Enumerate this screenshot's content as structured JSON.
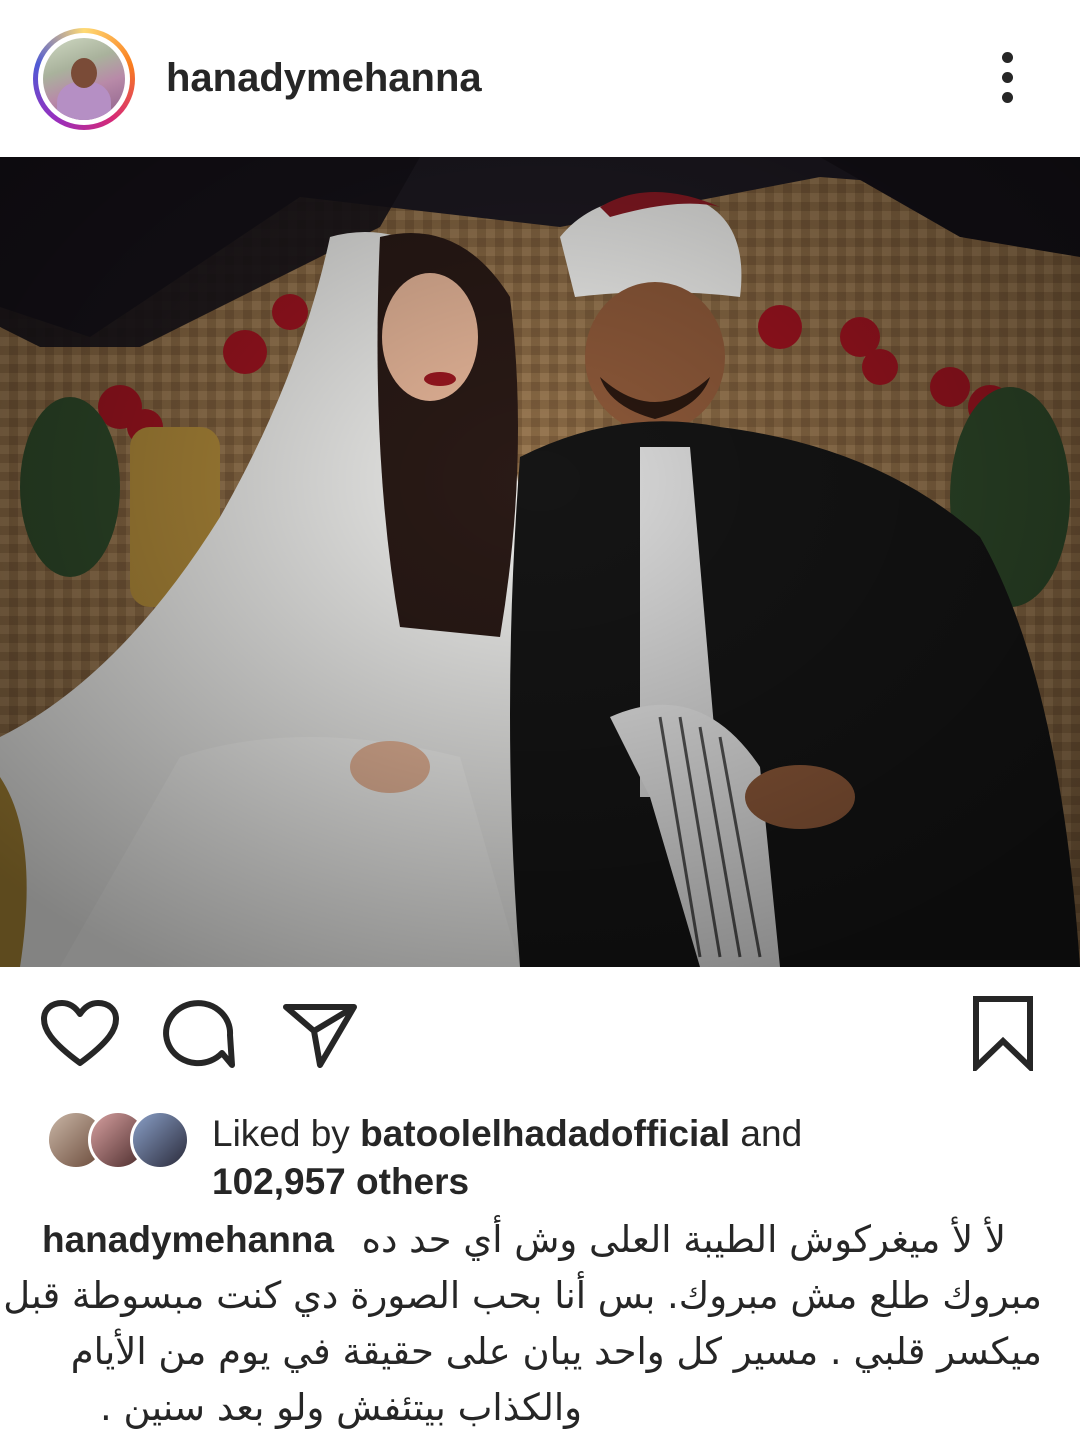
{
  "post": {
    "username": "hanadymehanna",
    "liked_by_prefix": "Liked by",
    "liked_by_user": "batoolelhadadofficial",
    "liked_by_and": "and",
    "others_count": "102,957 others",
    "caption_username": "hanadymehanna",
    "caption_lines": [
      "لأ لأ ميغركوش الطيبة العلى وش أي حد ده",
      "مبروك طلع مش مبروك. بس أنا بحب الصورة دي كنت مبسوطة قبل",
      "ميكسر قلبي . مسير كل واحد يبان على حقيقة في يوم من الأيام",
      "والكذاب بيتئفش ولو بعد سنين ."
    ]
  },
  "icons": {
    "more": "more-vertical-icon",
    "like": "heart-icon",
    "comment": "comment-icon",
    "share": "send-icon",
    "save": "bookmark-icon"
  },
  "colors": {
    "text": "#262626",
    "story_ring": [
      "#feda75",
      "#fa7e1e",
      "#d62976",
      "#962fbf",
      "#4f5bd5"
    ]
  }
}
